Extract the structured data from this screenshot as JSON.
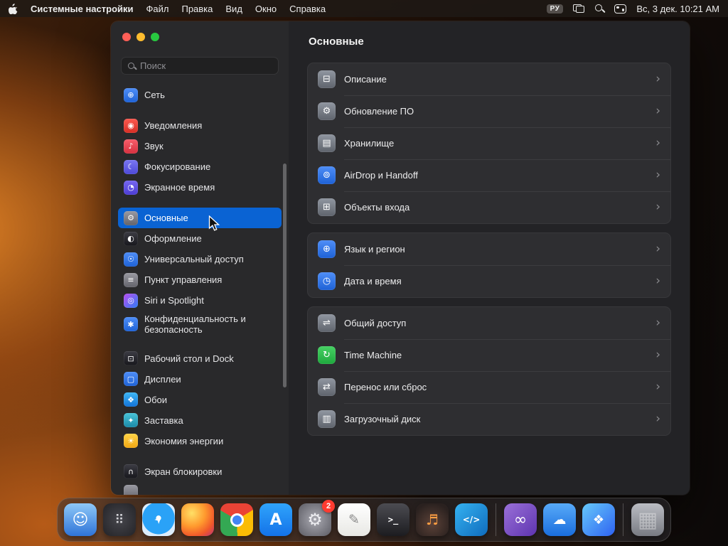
{
  "menubar": {
    "app_name": "Системные настройки",
    "menus": [
      "Файл",
      "Правка",
      "Вид",
      "Окно",
      "Справка"
    ],
    "input_source": "РУ",
    "clock": "Вс, 3 дек. 10:21 AM"
  },
  "window": {
    "sidebar": {
      "search_placeholder": "Поиск",
      "groups": [
        [
          {
            "id": "network",
            "label": "Сеть",
            "glyph": "⊕",
            "color": "linear-gradient(180deg,#4f8ef7,#1e62d6)"
          }
        ],
        [
          {
            "id": "notifications",
            "label": "Уведомления",
            "glyph": "◉",
            "color": "linear-gradient(180deg,#fc5a50,#d62e25)"
          },
          {
            "id": "sound",
            "label": "Звук",
            "glyph": "♪",
            "color": "linear-gradient(180deg,#f75e6b,#d6303f)"
          },
          {
            "id": "focus",
            "label": "Фокусирование",
            "glyph": "☾",
            "color": "linear-gradient(180deg,#7a77f2,#4d49d8)"
          },
          {
            "id": "screen-time",
            "label": "Экранное время",
            "glyph": "◔",
            "color": "linear-gradient(180deg,#7668f0,#4d3dd4)"
          }
        ],
        [
          {
            "id": "general",
            "label": "Основные",
            "glyph": "⚙",
            "color": "linear-gradient(180deg,#9a9aa2,#63636b)",
            "selected": true
          },
          {
            "id": "appearance",
            "label": "Оформление",
            "glyph": "◐",
            "color": "linear-gradient(180deg,#3c3c44,#17171c)"
          },
          {
            "id": "accessibility",
            "label": "Универсальный доступ",
            "glyph": "☉",
            "color": "linear-gradient(180deg,#4f8ef7,#1e62d6)"
          },
          {
            "id": "control-center",
            "label": "Пункт управления",
            "glyph": "≡",
            "color": "linear-gradient(180deg,#9a9aa2,#63636b)"
          },
          {
            "id": "siri-spotlight",
            "label": "Siri и Spotlight",
            "glyph": "◎",
            "color": "linear-gradient(135deg,#b94ef0,#2f7cf6)"
          },
          {
            "id": "privacy-security",
            "label": "Конфиденциальность и безопасность",
            "glyph": "✱",
            "color": "linear-gradient(180deg,#4f8ef7,#1e62d6)"
          }
        ],
        [
          {
            "id": "desktop-dock",
            "label": "Рабочий стол и Dock",
            "glyph": "⊡",
            "color": "linear-gradient(180deg,#3c3c44,#17171c)"
          },
          {
            "id": "displays",
            "label": "Дисплеи",
            "glyph": "▢",
            "color": "linear-gradient(180deg,#4f8ef7,#1e62d6)"
          },
          {
            "id": "wallpaper",
            "label": "Обои",
            "glyph": "❖",
            "color": "linear-gradient(180deg,#3fb7f5,#1273d8)"
          },
          {
            "id": "screen-saver",
            "label": "Заставка",
            "glyph": "✦",
            "color": "linear-gradient(180deg,#49c3d8,#1b8aa8)"
          },
          {
            "id": "energy",
            "label": "Экономия энергии",
            "glyph": "☀",
            "color": "linear-gradient(180deg,#ffd348,#f0a713)"
          }
        ],
        [
          {
            "id": "lock-screen",
            "label": "Экран блокировки",
            "glyph": "∩",
            "color": "linear-gradient(180deg,#3c3c44,#17171c)"
          },
          {
            "id": "partial",
            "label": "",
            "glyph": "",
            "color": "linear-gradient(180deg,#9a9aa2,#63636b)"
          }
        ]
      ]
    },
    "content": {
      "title": "Основные",
      "chevron": "›",
      "groups": [
        [
          {
            "id": "about",
            "label": "Описание",
            "glyph": "⊟",
            "color": "linear-gradient(180deg,#9096a0,#5f646d)"
          },
          {
            "id": "software-update",
            "label": "Обновление ПО",
            "glyph": "⚙",
            "color": "linear-gradient(180deg,#9096a0,#5f646d)"
          },
          {
            "id": "storage",
            "label": "Хранилище",
            "glyph": "▤",
            "color": "linear-gradient(180deg,#9096a0,#5f646d)"
          },
          {
            "id": "airdrop-handoff",
            "label": "AirDrop и Handoff",
            "glyph": "⊚",
            "color": "linear-gradient(180deg,#4f8ef7,#1e62d6)"
          },
          {
            "id": "login-items",
            "label": "Объекты входа",
            "glyph": "⊞",
            "color": "linear-gradient(180deg,#9096a0,#5f646d)"
          }
        ],
        [
          {
            "id": "language-region",
            "label": "Язык и регион",
            "glyph": "⊕",
            "color": "linear-gradient(180deg,#4f8ef7,#1e62d6)"
          },
          {
            "id": "date-time",
            "label": "Дата и время",
            "glyph": "◷",
            "color": "linear-gradient(180deg,#4f8ef7,#1e62d6)"
          }
        ],
        [
          {
            "id": "sharing",
            "label": "Общий доступ",
            "glyph": "⇌",
            "color": "linear-gradient(180deg,#9096a0,#5f646d)"
          },
          {
            "id": "time-machine",
            "label": "Time Machine",
            "glyph": "↻",
            "color": "linear-gradient(180deg,#47d164,#1fa93e)"
          },
          {
            "id": "transfer-reset",
            "label": "Перенос или сброс",
            "glyph": "⇄",
            "color": "linear-gradient(180deg,#9096a0,#5f646d)"
          },
          {
            "id": "startup-disk",
            "label": "Загрузочный диск",
            "glyph": "▥",
            "color": "linear-gradient(180deg,#9096a0,#5f646d)"
          }
        ]
      ]
    }
  },
  "dock": {
    "items": [
      {
        "id": "finder",
        "glyph": "☺",
        "style": "background:linear-gradient(180deg,#8ec8f8,#2f74d8)",
        "glyph_style": "font-size:22px"
      },
      {
        "id": "launchpad",
        "glyph": "⠿",
        "style": "background:radial-gradient(circle,#46464c,#232327)",
        "glyph_style": "font-size:18px;color:#d6d6da"
      },
      {
        "id": "safari",
        "glyph": "➤",
        "style": "background:radial-gradient(circle at 50% 45%,#ffffff 0 10%,#2aa2f7 11% 66%,#dcecfb 67%)",
        "glyph_style": "font-size:13px;transform:rotate(-45deg)"
      },
      {
        "id": "firefox",
        "glyph": "",
        "style": "background:radial-gradient(circle at 32% 30%,#ffe066,#ff9a2e 42%,#f0582a 72%,#b5327c)"
      },
      {
        "id": "chrome",
        "glyph": "",
        "style": "background:conic-gradient(from -60deg,#ea4335 0 33%,#fbbc05 0 66%,#34a853 0 100%)",
        "glyph_style": "width:19px;height:19px;border-radius:50%;background:#4285f4;border:3px solid #fff"
      },
      {
        "id": "app-store",
        "glyph": "A",
        "style": "background:linear-gradient(180deg,#30a4fc,#1372e8)",
        "glyph_style": "font-size:22px;font-weight:600"
      },
      {
        "id": "system-settings",
        "glyph": "⚙",
        "style": "background:radial-gradient(circle,#aaaab2,#5c5c64)",
        "glyph_style": "font-size:24px;color:#ececf0",
        "badge": "2"
      },
      {
        "id": "textedit",
        "glyph": "✎",
        "style": "background:linear-gradient(180deg,#ffffff,#e8e8e4)",
        "glyph_style": "font-size:19px;color:#8a8a8a"
      },
      {
        "id": "terminal",
        "glyph": ">_",
        "style": "background:linear-gradient(180deg,#4c4c52,#1c1c20)",
        "glyph_style": "font-family:'DejaVu Sans Mono',monospace;font-size:12px;font-weight:700"
      },
      {
        "id": "garageband",
        "glyph": "♬",
        "style": "background:radial-gradient(circle at 50% 62%,#5c4238,#2a211f 78%)",
        "glyph_style": "font-size:20px;color:#ff9f43"
      },
      {
        "id": "vscode",
        "glyph": "</>",
        "style": "background:linear-gradient(135deg,#35b2f1,#0f6cbd)",
        "glyph_style": "font-size:12px;font-weight:700"
      },
      {
        "sep": true
      },
      {
        "id": "visual-studio",
        "glyph": "∞",
        "style": "background:linear-gradient(135deg,#9a70d8,#5e34b0)",
        "glyph_style": "font-size:22px"
      },
      {
        "id": "weather",
        "glyph": "☁",
        "style": "background:linear-gradient(180deg,#58aaf8,#1a6ede)",
        "glyph_style": "font-size:19px"
      },
      {
        "id": "shortcuts",
        "glyph": "❖",
        "style": "background:linear-gradient(135deg,#66c9fa,#2e62f2)",
        "glyph_style": "font-size:18px"
      },
      {
        "sep": true
      },
      {
        "id": "trash",
        "glyph": "▦",
        "style": "background:linear-gradient(180deg,rgba(214,217,224,.85),rgba(142,146,155,.8))",
        "glyph_style": "font-size:30px;color:rgba(255,255,255,.35)"
      }
    ]
  }
}
